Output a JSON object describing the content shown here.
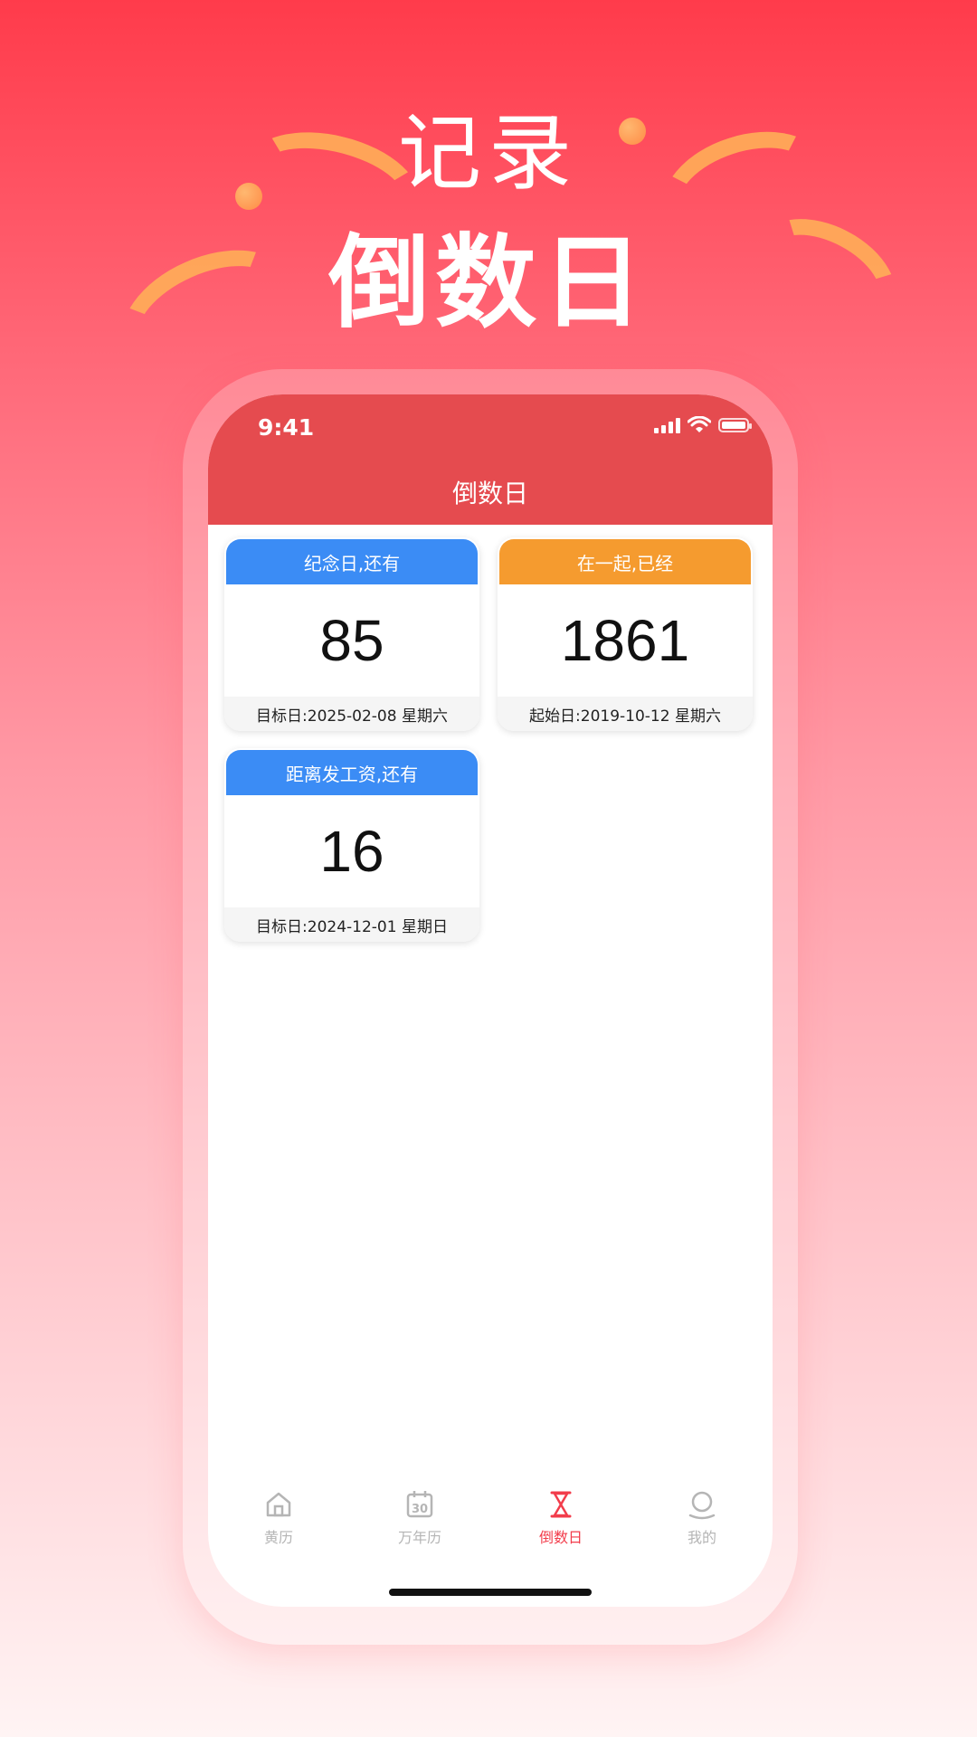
{
  "hero": {
    "line1": "记录",
    "line2": "倒数日"
  },
  "status_bar": {
    "time": "9:41"
  },
  "app": {
    "title": "倒数日"
  },
  "cards": [
    {
      "header": "纪念日,还有",
      "count": "85",
      "footer": "目标日:2025-02-08 星期六",
      "color": "#3b8cf5"
    },
    {
      "header": "在一起,已经",
      "count": "1861",
      "footer": "起始日:2019-10-12 星期六",
      "color": "#f59b2f"
    },
    {
      "header": "距离发工资,还有",
      "count": "16",
      "footer": "目标日:2024-12-01 星期日",
      "color": "#3b8cf5"
    }
  ],
  "tabs": [
    {
      "label": "黄历",
      "icon": "home-icon",
      "active": false
    },
    {
      "label": "万年历",
      "icon": "calendar-icon",
      "active": false
    },
    {
      "label": "倒数日",
      "icon": "hourglass-icon",
      "active": true
    },
    {
      "label": "我的",
      "icon": "profile-icon",
      "active": false
    }
  ],
  "colors": {
    "header_red": "#e54b4f",
    "tab_active": "#f23c4b",
    "tab_inactive": "#b5b5b5"
  }
}
